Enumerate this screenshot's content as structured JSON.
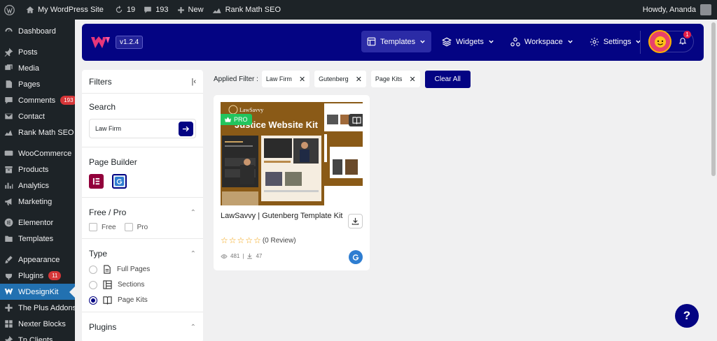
{
  "admin_bar": {
    "site_name": "My WordPress Site",
    "updates_count": "19",
    "comments_count": "193",
    "new_label": "New",
    "seo_label": "Rank Math SEO",
    "howdy": "Howdy, Ananda"
  },
  "sidebar": {
    "items": [
      {
        "label": "Dashboard",
        "icon": "dashboard-icon"
      },
      {
        "label": "Posts",
        "icon": "pin-icon"
      },
      {
        "label": "Media",
        "icon": "media-icon"
      },
      {
        "label": "Pages",
        "icon": "pages-icon"
      },
      {
        "label": "Comments",
        "icon": "comment-icon",
        "badge": "193"
      },
      {
        "label": "Contact",
        "icon": "mail-icon"
      },
      {
        "label": "Rank Math SEO",
        "icon": "chart-icon"
      },
      {
        "label": "WooCommerce",
        "icon": "woo-icon"
      },
      {
        "label": "Products",
        "icon": "archive-icon"
      },
      {
        "label": "Analytics",
        "icon": "bars-icon"
      },
      {
        "label": "Marketing",
        "icon": "megaphone-icon"
      },
      {
        "label": "Elementor",
        "icon": "elementor-icon"
      },
      {
        "label": "Templates",
        "icon": "folder-icon"
      },
      {
        "label": "Appearance",
        "icon": "brush-icon"
      },
      {
        "label": "Plugins",
        "icon": "plug-icon",
        "badge": "11"
      },
      {
        "label": "WDesignKit",
        "icon": "wdk-icon",
        "active": true
      },
      {
        "label": "The Plus Addons",
        "icon": "plus-icon"
      },
      {
        "label": "Nexter Blocks",
        "icon": "blocks-icon"
      },
      {
        "label": "Tp Clients",
        "icon": "pin-icon"
      }
    ]
  },
  "header": {
    "version": "v1.2.4",
    "nav": [
      {
        "label": "Templates",
        "icon": "template-icon",
        "active": true
      },
      {
        "label": "Widgets",
        "icon": "layers-icon"
      },
      {
        "label": "Workspace",
        "icon": "workspace-icon"
      },
      {
        "label": "Settings",
        "icon": "gear-icon"
      }
    ],
    "notification_count": "1"
  },
  "filters": {
    "title": "Filters",
    "search": {
      "title": "Search",
      "value": "Law Firm"
    },
    "page_builder": {
      "title": "Page Builder"
    },
    "free_pro": {
      "title": "Free / Pro",
      "options": [
        "Free",
        "Pro"
      ]
    },
    "type": {
      "title": "Type",
      "options": [
        "Full Pages",
        "Sections",
        "Page Kits"
      ],
      "selected": "Page Kits"
    },
    "plugins": {
      "title": "Plugins"
    }
  },
  "applied": {
    "label": "Applied Filter :",
    "chips": [
      "Law Firm",
      "Gutenberg",
      "Page Kits"
    ],
    "clear_label": "Clear All"
  },
  "card": {
    "badge": "PRO",
    "thumb_brand": "LawSavvy",
    "thumb_heading": "Justice Website Kit",
    "title": "LawSavvy | Gutenberg Template Kit",
    "rating": 0,
    "review_text": "(0 Review)",
    "views": "481",
    "downloads": "47"
  },
  "help_label": "?"
}
